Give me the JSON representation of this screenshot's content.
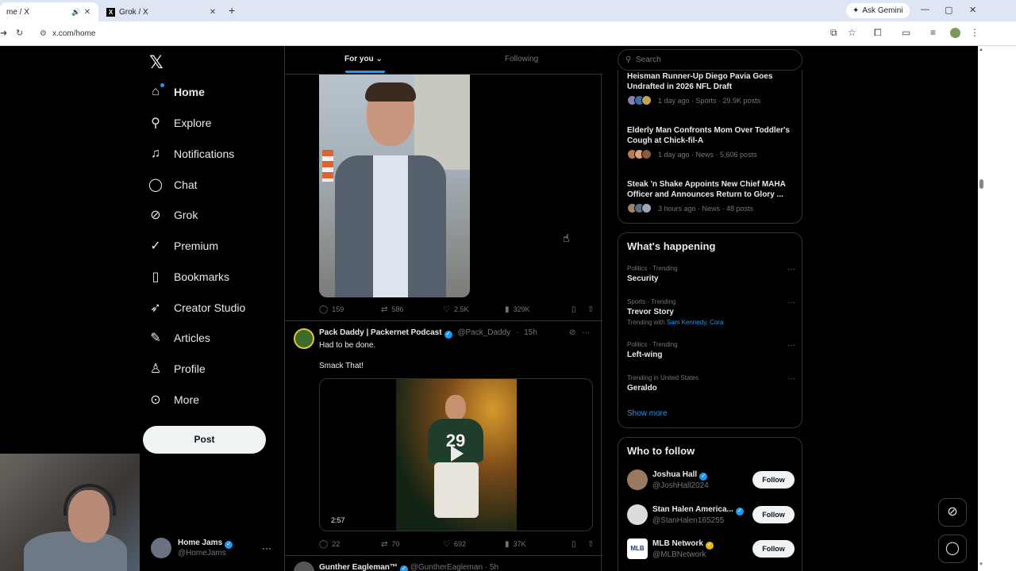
{
  "browser": {
    "tabs": [
      {
        "title": "me / X",
        "active": true
      },
      {
        "title": "Grok / X",
        "active": false
      }
    ],
    "new_tab": "+",
    "ask_gemini": "Ask Gemini",
    "url": "x.com/home",
    "window_controls": [
      "—",
      "▢",
      "✕"
    ]
  },
  "nav": {
    "logo": "𝕏",
    "items": [
      {
        "label": "Home",
        "icon": "home-icon",
        "glyph": "⌂"
      },
      {
        "label": "Explore",
        "icon": "search-icon",
        "glyph": "⚲"
      },
      {
        "label": "Notifications",
        "icon": "bell-icon",
        "glyph": "🔔"
      },
      {
        "label": "Chat",
        "icon": "chat-icon",
        "glyph": "◯"
      },
      {
        "label": "Grok",
        "icon": "grok-icon",
        "glyph": "⊘"
      },
      {
        "label": "Premium",
        "icon": "verified-icon",
        "glyph": "✓"
      },
      {
        "label": "Bookmarks",
        "icon": "bookmark-icon",
        "glyph": "▯"
      },
      {
        "label": "Creator Studio",
        "icon": "rocket-icon",
        "glyph": "➶"
      },
      {
        "label": "Articles",
        "icon": "articles-icon",
        "glyph": "✎"
      },
      {
        "label": "Profile",
        "icon": "person-icon",
        "glyph": "♙"
      },
      {
        "label": "More",
        "icon": "more-circle-icon",
        "glyph": "⊙"
      }
    ],
    "post_button": "Post",
    "account": {
      "name": "Home Jams",
      "handle": "@HomeJams",
      "more": "···"
    }
  },
  "feed": {
    "tabs": {
      "for_you": "For you",
      "following": "Following"
    },
    "tweet1": {
      "stats": {
        "replies": "159",
        "reposts": "586",
        "likes": "2.5K",
        "views": "329K"
      }
    },
    "tweet2": {
      "name": "Pack Daddy | Packernet Podcast",
      "handle": "@Pack_Daddy",
      "time": "15h",
      "text1": "Had to be done.",
      "text2": "Smack That!",
      "jersey": "29",
      "duration": "2:57",
      "stats": {
        "replies": "22",
        "reposts": "70",
        "likes": "692",
        "views": "37K"
      }
    },
    "tweet3": {
      "name": "Gunther Eagleman™",
      "handle": "@GuntherEagleman",
      "time": "5h"
    }
  },
  "sidebar": {
    "search_placeholder": "Search",
    "news": [
      {
        "title": "Heisman Runner-Up Diego Pavia Goes Undrafted in 2026 NFL Draft",
        "meta": "1 day ago · Sports · 29.9K posts"
      },
      {
        "title": "Elderly Man Confronts Mom Over Toddler's Cough at Chick-fil-A",
        "meta": "1 day ago · News · 5,606 posts"
      },
      {
        "title": "Steak 'n Shake Appoints New Chief MAHA Officer and Announces Return to Glory ...",
        "meta": "3 hours ago · News · 48 posts"
      }
    ],
    "whats_happening": {
      "title": "What's happening",
      "trends": [
        {
          "category": "Politics · Trending",
          "name": "Security"
        },
        {
          "category": "Sports · Trending",
          "name": "Trevor Story",
          "with_prefix": "Trending with",
          "with_links": "Sam Kennedy, Cora"
        },
        {
          "category": "Politics · Trending",
          "name": "Left-wing"
        },
        {
          "category": "Trending in United States",
          "name": "Geraldo"
        }
      ],
      "show_more": "Show more"
    },
    "who_to_follow": {
      "title": "Who to follow",
      "accounts": [
        {
          "name": "Joshua Hall",
          "handle": "@JoshHall2024",
          "button": "Follow",
          "badge": "blue"
        },
        {
          "name": "Stan Halen America...",
          "handle": "@StanHalen165255",
          "button": "Follow",
          "badge": "blue"
        },
        {
          "name": "MLB Network",
          "handle": "@MLBNetwork",
          "button": "Follow",
          "badge": "gold",
          "logo": "MLB"
        }
      ]
    }
  }
}
